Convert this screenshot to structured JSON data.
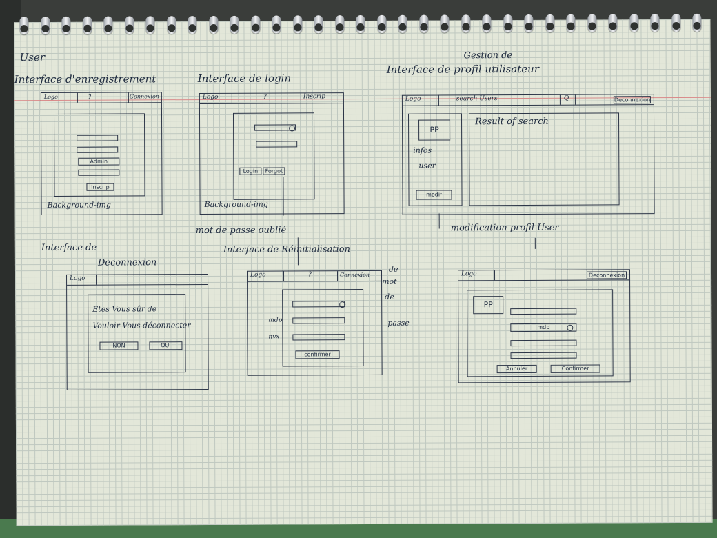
{
  "page_title": "User",
  "sections": {
    "register": {
      "title": "Interface d'enregistrement",
      "nav_logo": "Logo",
      "nav_search": "?",
      "nav_link": "Connexion",
      "select_label": "Admin",
      "submit_label": "Inscrip",
      "background": "Background-img"
    },
    "login": {
      "title": "Interface de login",
      "nav_logo": "Logo",
      "nav_search": "?",
      "nav_link": "Inscrip",
      "login_btn": "Login",
      "forgot_btn": "Forgot",
      "background": "Background-img",
      "forgot_note": "mot de passe oublié"
    },
    "manage": {
      "title_line1": "Gestion de",
      "title_line2": "Interface de profil utilisateur",
      "nav_logo": "Logo",
      "nav_search": "search Users",
      "nav_search_icon": "Q",
      "nav_logout": "Deconnexion",
      "profile_pic": "PP",
      "infos_line1": "infos",
      "infos_line2": "user",
      "modify_btn": "modif",
      "results": "Result of search",
      "modify_note": "modification profil User"
    },
    "logout": {
      "title_line1": "Interface de",
      "title_line2": "Deconnexion",
      "nav_logo": "Logo",
      "question_line1": "Etes Vous sûr de",
      "question_line2": "Vouloir Vous déconnecter",
      "no_btn": "NON",
      "yes_btn": "OUI"
    },
    "reset": {
      "title": "Interface de Réinitialisation",
      "side_1": "de",
      "side_2": "mot",
      "side_3": "de",
      "side_4": "passe",
      "nav_logo": "Logo",
      "nav_search": "?",
      "nav_link": "Connexion",
      "mdp_label": "mdp",
      "nvx_label": "nvx",
      "confirm_btn": "confirmer"
    },
    "edit": {
      "nav_logo": "Logo",
      "nav_logout": "Deconnexion",
      "profile_pic": "PP",
      "pwd_field": "mdp",
      "cancel_btn": "Annuler",
      "confirm_btn": "Confirmer"
    }
  }
}
